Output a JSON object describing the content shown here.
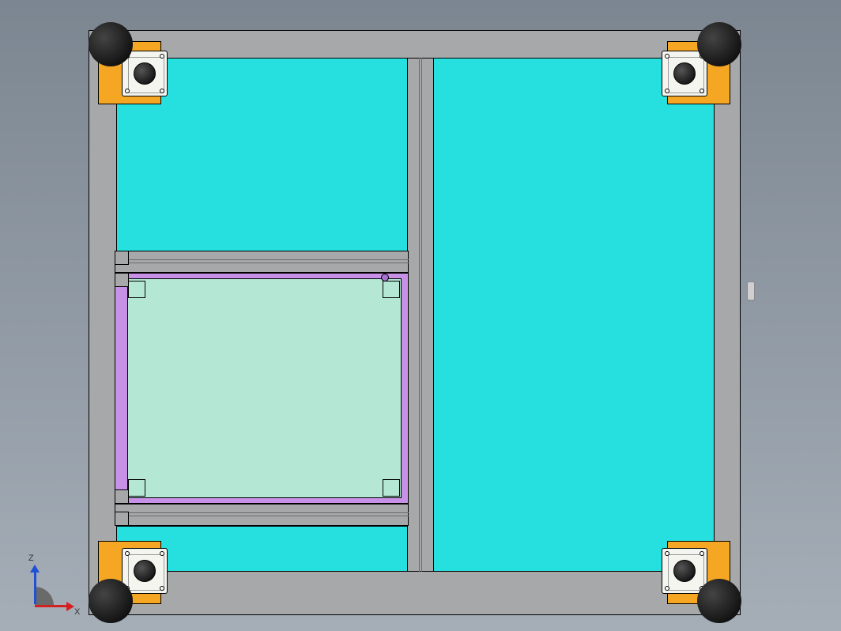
{
  "view": {
    "axes": {
      "x_label": "X",
      "z_label": "Z"
    }
  },
  "colors": {
    "frame": "#a7a8a9",
    "panel_cyan": "#26e0e0",
    "panel_light": "#b4e8d4",
    "purple": "#c891e8",
    "bracket": "#f5a623",
    "sphere": "#000000",
    "axis_x": "#d42020",
    "axis_z": "#2050d4"
  },
  "model": {
    "components": [
      "outer-aluminum-frame",
      "vertical-divider-beam",
      "horizontal-divider-beam-upper",
      "horizontal-divider-beam-lower",
      "cyan-panel-top-left",
      "cyan-panel-right",
      "cyan-panel-bottom-left",
      "purple-subframe",
      "light-green-plate",
      "corner-bracket-top-left",
      "corner-bracket-top-right",
      "corner-bracket-bottom-left",
      "corner-bracket-bottom-right",
      "motor-plate-top-left",
      "motor-plate-top-right",
      "motor-plate-bottom-left",
      "motor-plate-bottom-right",
      "foot-sphere-top-left",
      "foot-sphere-top-right",
      "foot-sphere-bottom-left",
      "foot-sphere-bottom-right"
    ]
  }
}
